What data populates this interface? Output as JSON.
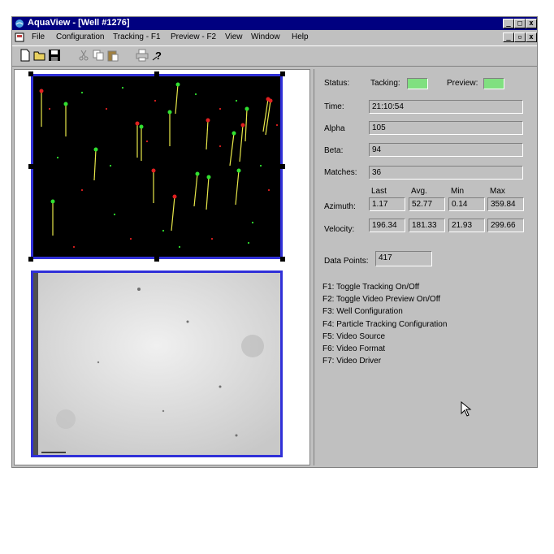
{
  "window": {
    "title": "AquaView - [Well #1276]",
    "controls": {
      "min": "_",
      "max": "□",
      "close": "x",
      "child_min": "_",
      "child_restore": "▫",
      "child_close": "x"
    }
  },
  "menu": [
    {
      "label": "File"
    },
    {
      "label": "Configuration"
    },
    {
      "label": "Tracking - F1"
    },
    {
      "label": "Preview - F2"
    },
    {
      "label": "View"
    },
    {
      "label": "Window"
    },
    {
      "label": "Help"
    }
  ],
  "toolbar": [
    "new-icon",
    "open-icon",
    "save-icon",
    "cut-icon",
    "copy-icon",
    "paste-icon",
    "print-icon",
    "help-icon"
  ],
  "status": {
    "status_label": "Status:",
    "tracking_label": "Tacking:",
    "preview_label": "Preview:",
    "indicator_color": "#80e080"
  },
  "fields": {
    "time": {
      "label": "Time:",
      "value": "21:10:54"
    },
    "alpha": {
      "label": "Alpha",
      "value": "105"
    },
    "beta": {
      "label": "Beta:",
      "value": "94"
    },
    "matches": {
      "label": "Matches:",
      "value": "36"
    }
  },
  "stats": {
    "headers": [
      "Last",
      "Avg.",
      "Min",
      "Max"
    ],
    "azimuth": {
      "label": "Azimuth:",
      "values": [
        "1.17",
        "52.77",
        "0.14",
        "359.84"
      ]
    },
    "velocity": {
      "label": "Velocity:",
      "values": [
        "196.34",
        "181.33",
        "21.93",
        "299.66"
      ]
    }
  },
  "data_points": {
    "label": "Data Points:",
    "value": "417"
  },
  "help_lines": [
    "F1: Toggle Tracking On/Off",
    "F2: Toggle Video Preview On/Off",
    "F3: Well Configuration",
    "F4: Particle Tracking Configuration",
    "F5: Video Source",
    "F6: Video Format",
    "F7: Video Driver"
  ],
  "colors": {
    "titlebar": "#000080",
    "image_border": "#3030d8",
    "track_line": "#e8e84a",
    "particle_red": "#e02020",
    "particle_green": "#30e030"
  }
}
